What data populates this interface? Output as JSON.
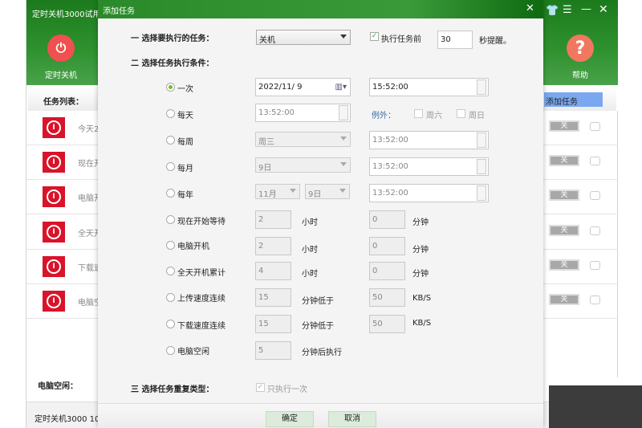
{
  "app": {
    "title": "定时关机3000试用",
    "nav_left": "定时关机",
    "nav_help": "帮助",
    "task_list_label": "任务列表：",
    "add_task": "添加任务",
    "idle_label": "电脑空闲：",
    "status": "定时关机3000 10",
    "rows": [
      {
        "text": "今天2",
        "toggle": "关"
      },
      {
        "text": "现在开",
        "toggle": "关"
      },
      {
        "text": "电脑开",
        "toggle": "关"
      },
      {
        "text": "全天开",
        "toggle": "关"
      },
      {
        "text": "下载速",
        "toggle": "关"
      },
      {
        "text": "电脑空",
        "toggle": "关"
      }
    ]
  },
  "dialog": {
    "title": "添加任务",
    "s1": "一 选择要执行的任务：",
    "task": "关机",
    "remind_label": "执行任务前",
    "remind_checked": true,
    "remind_secs": "30",
    "remind_suffix": "秒提醒。",
    "s2": "二 选择任务执行条件：",
    "once": {
      "label": "一次",
      "date": "2022/11/ 9",
      "time": "15:52:00",
      "selected": true
    },
    "daily": {
      "label": "每天",
      "time": "13:52:00",
      "except": "例外：",
      "sat": "周六",
      "sun": "周日"
    },
    "weekly": {
      "label": "每周",
      "day": "周三",
      "time": "13:52:00"
    },
    "monthly": {
      "label": "每月",
      "day": "9日",
      "time": "13:52:00"
    },
    "yearly": {
      "label": "每年",
      "month": "11月",
      "day": "9日",
      "time": "13:52:00"
    },
    "wait": {
      "label": "现在开始等待",
      "v1": "2",
      "u1": "小时",
      "v2": "0",
      "u2": "分钟"
    },
    "boot": {
      "label": "电脑开机",
      "v1": "2",
      "u1": "小时",
      "v2": "0",
      "u2": "分钟"
    },
    "uptime": {
      "label": "全天开机累计",
      "v1": "4",
      "u1": "小时",
      "v2": "0",
      "u2": "分钟"
    },
    "upload": {
      "label": "上传速度连续",
      "v1": "15",
      "u1": "分钟低于",
      "v2": "50",
      "u2": "KB/S"
    },
    "download": {
      "label": "下载速度连续",
      "v1": "15",
      "u1": "分钟低于",
      "v2": "50",
      "u2": "KB/S"
    },
    "idle": {
      "label": "电脑空闲",
      "v1": "5",
      "u1": "分钟后执行"
    },
    "s3": "三 选择任务重复类型：",
    "once_only": "只执行一次",
    "once_only_checked": true,
    "ok": "确定",
    "cancel": "取消"
  },
  "colors": {
    "green": "#2f922f",
    "red": "#d9132a",
    "help": "#f07860",
    "blue_btn": "#7aa8f0"
  }
}
